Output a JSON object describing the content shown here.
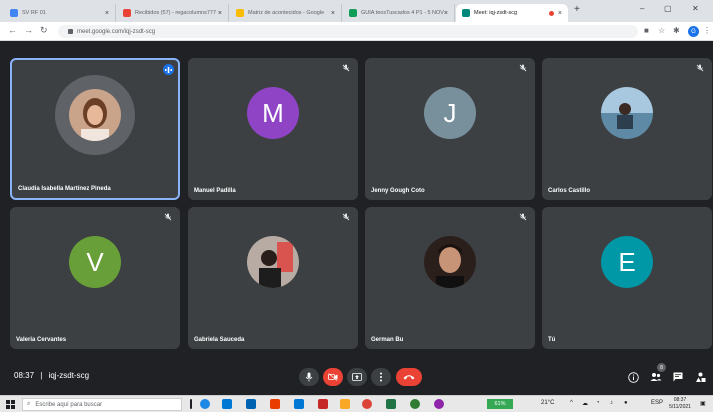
{
  "browser": {
    "tabs": [
      {
        "title": "SV RF 01",
        "icon_color": "#4285f4",
        "active": false
      },
      {
        "title": "Recibidos (57) - regacolumns777",
        "icon_color": "#ea4335",
        "active": false
      },
      {
        "title": "Matriz de acontecidos - Google",
        "icon_color": "#fbbc04",
        "active": false
      },
      {
        "title": "GUIA teosTuscados 4 P1 - 5 NOV",
        "icon_color": "#0f9d58",
        "active": false
      },
      {
        "title": "Meet: iqj-zsdt-scg",
        "icon_color": "#00897b",
        "active": true
      }
    ],
    "new_tab": "+",
    "url": "meet.google.com/iqj-zsdt-scg",
    "profile_initial": "G"
  },
  "participants": [
    {
      "name": "Claudia Isabella Martínez Pineda",
      "type": "photo",
      "photo_color": "#c08a6a",
      "speaking": true
    },
    {
      "name": "Manuel Padilla",
      "type": "letter",
      "letter": "M",
      "color": "#8e44c4",
      "muted": true
    },
    {
      "name": "Jenny Gough Coto",
      "type": "letter",
      "letter": "J",
      "color": "#78909c",
      "muted": true
    },
    {
      "name": "Carlos Castillo",
      "type": "photo",
      "photo_color": "#7aa0b8",
      "muted": true
    },
    {
      "name": "Valeria Cervantes",
      "type": "letter",
      "letter": "V",
      "color": "#689f38",
      "muted": true
    },
    {
      "name": "Gabriela Sauceda",
      "type": "photo",
      "photo_color": "#8d7a70",
      "muted": true
    },
    {
      "name": "German Bu",
      "type": "photo",
      "photo_color": "#3a2a22",
      "muted": true
    },
    {
      "name": "Tú",
      "type": "letter",
      "letter": "E",
      "color": "#0097a7",
      "muted": false
    }
  ],
  "meeting": {
    "time": "08:37",
    "separator": "|",
    "code": "iqj-zsdt-scg",
    "participant_count": "8"
  },
  "taskbar": {
    "search_placeholder": "Escribe aquí para buscar",
    "battery": "61%",
    "temperature": "21°C",
    "language": "ESP",
    "clock_time": "08:37",
    "clock_date": "5/11/2021"
  }
}
